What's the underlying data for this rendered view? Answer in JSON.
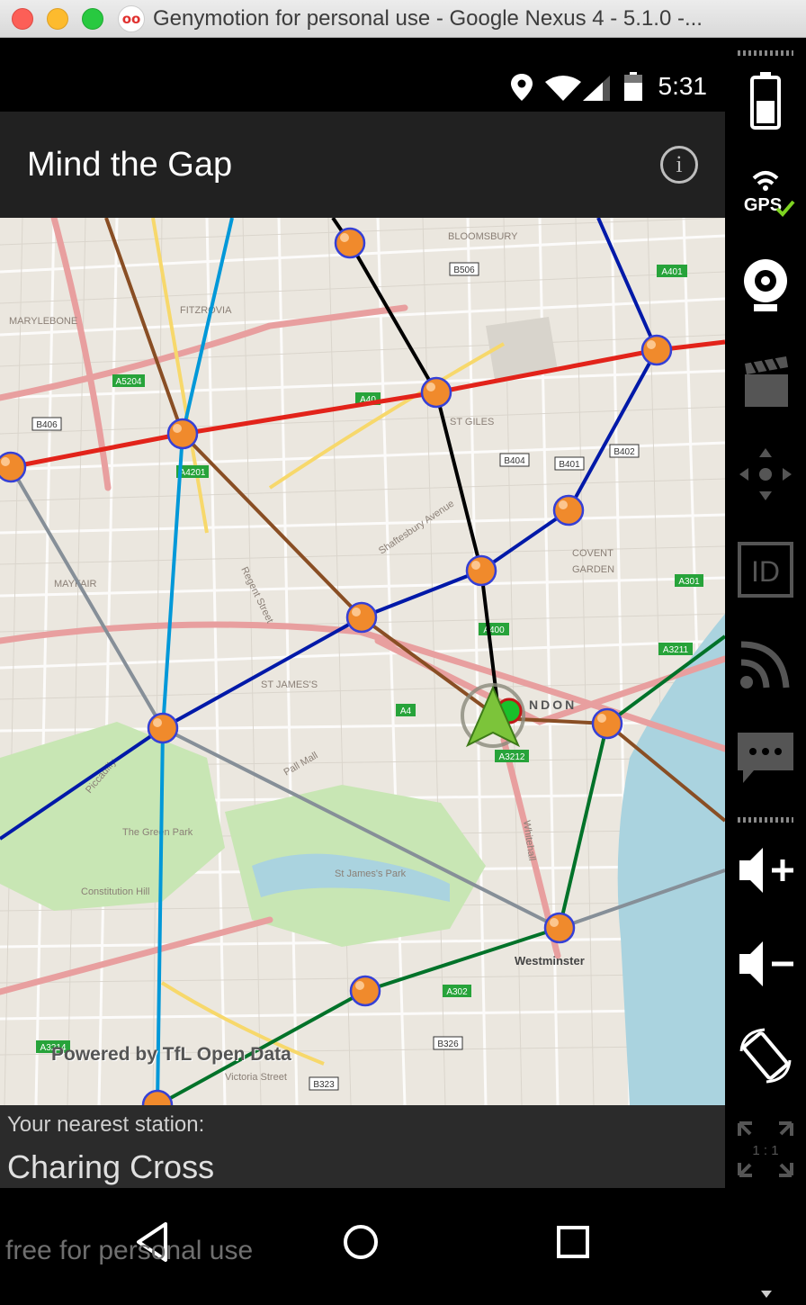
{
  "window": {
    "title": "Genymotion for personal use - Google Nexus 4 - 5.1.0 -...",
    "app_icon": "oo"
  },
  "statusbar": {
    "time": "5:31",
    "icons": [
      "location-icon",
      "wifi-icon",
      "signal-icon",
      "battery-icon"
    ]
  },
  "appbar": {
    "title": "Mind the Gap",
    "info_label": "i"
  },
  "map": {
    "attribution": "Powered by TfL Open Data",
    "labels": {
      "bloomsbury": "BLOOMSBURY",
      "marylebone": "MARYLEBONE",
      "fitzrovia": "FITZROVIA",
      "st_giles": "ST GILES",
      "covent_garden_1": "COVENT",
      "covent_garden_2": "GARDEN",
      "mayfair": "MAYFAIR",
      "st_james": "ST JAMES'S",
      "london": "NDON",
      "westminster": "Westminster",
      "shaftesbury": "Shaftesbury Avenue",
      "regent": "Regent Street",
      "pall_mall": "Pall Mall",
      "piccadilly": "Piccadilly",
      "green_park": "The Green Park",
      "st_james_park": "St James's Park",
      "constitution": "Constitution Hill",
      "victoria": "Victoria Street",
      "whitehall": "Whitehall"
    },
    "road_badges": [
      "A401",
      "A5204",
      "A40",
      "B406",
      "A4201",
      "B506",
      "B404",
      "B401",
      "B402",
      "A400",
      "A4",
      "A3212",
      "A3211",
      "A301",
      "A302",
      "B326",
      "B323",
      "A3214"
    ]
  },
  "nearest": {
    "label": "Your nearest station:",
    "station": "Charing Cross"
  },
  "watermark": "free for personal use",
  "sidebar": {
    "gps_label": "GPS",
    "id_label": "ID",
    "ratio_label": "1 : 1",
    "items": [
      "battery-icon",
      "gps-icon",
      "webcam-icon",
      "screencast-icon",
      "dpad-icon",
      "id-icon",
      "rss-icon",
      "sms-icon",
      "volume-up-icon",
      "volume-down-icon",
      "rotate-icon",
      "pixel-ratio-icon"
    ]
  },
  "colors": {
    "line_red": "#e2231a",
    "line_blue": "#0019a8",
    "line_lightblue": "#0098d8",
    "line_black": "#000000",
    "line_brown": "#894e24",
    "line_grey": "#868f98",
    "line_green": "#007229",
    "station_fill": "#f08a2c",
    "water": "#aad3df",
    "park": "#c8e6b4"
  }
}
